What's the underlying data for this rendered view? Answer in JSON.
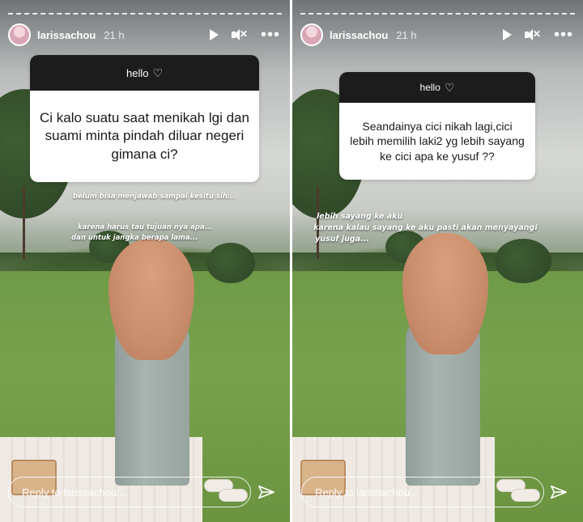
{
  "stories": [
    {
      "username": "larissachou",
      "time": "21 h",
      "question_header": "hello",
      "question_text": "Ci kalo suatu saat menikah lgi dan suami minta pindah diluar negeri gimana ci?",
      "answer_lines": [
        "belum bisa menjawab sampai kesitu sih...",
        "karena harus tau tujuan nya apa...",
        "dan untuk jangka berapa lama..."
      ],
      "reply_placeholder": "Reply to larissachou..."
    },
    {
      "username": "larissachou",
      "time": "21 h",
      "question_header": "hello",
      "question_text": "Seandainya cici nikah lagi,cici lebih memilih laki2 yg lebih sayang ke cici apa ke yusuf ??",
      "answer_lines": [
        "lebih sayang ke aku",
        "karena kalau sayang ke aku pasti akan menyayangi",
        "yusuf juga..."
      ],
      "reply_placeholder": "Reply to larissachou..."
    }
  ],
  "icons": {
    "play": "play-icon",
    "mute": "mute-icon",
    "more": "more-icon",
    "heart": "heart-icon",
    "send": "send-icon"
  },
  "colors": {
    "question_header_bg": "#1c1c1c",
    "hijab": "#c98d6c",
    "dress": "#a8b4b0",
    "grass": "#6f9a47"
  }
}
